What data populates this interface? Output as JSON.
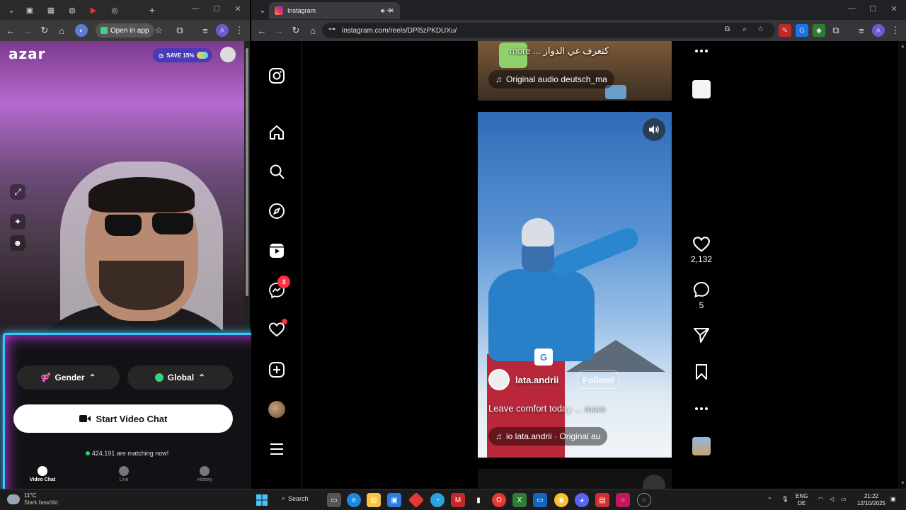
{
  "left_browser": {
    "toolbar": {
      "open_in_app_label": "Open in app",
      "profile_letter": "A"
    }
  },
  "azar": {
    "logo": "azar",
    "save_badge": "SAVE 15%",
    "gender_label": "Gender",
    "global_label": "Global",
    "start_button_label": "Start Video Chat",
    "matching_text": "424,191 are matching now!",
    "nav": [
      {
        "label": "Video Chat",
        "active": true
      },
      {
        "label": "Live",
        "active": false
      },
      {
        "label": "History",
        "active": false
      }
    ],
    "colors": {
      "neon_border": "#36c8ff",
      "neon_glow": "#d23bff",
      "matching_dot": "#27d36a"
    }
  },
  "right_browser": {
    "tab_title": "Instagram",
    "url": "instagram.com/reels/DPl5zPKDUXu/",
    "profile_letter": "A"
  },
  "instagram": {
    "messages_badge": "3",
    "prev_reel": {
      "caption": "كتعرف غي الدواز",
      "more": "more ...",
      "audio": "Original audio  deutsch_ma"
    },
    "reel": {
      "username": "lata.andrii",
      "follow_label": "Followi",
      "caption": "Leave comfort today",
      "more": "... more",
      "audio": "io  lata.andrii · Original au"
    },
    "actions": {
      "likes": "2,132",
      "comments": "5"
    },
    "colors": {
      "badge": "#ff3040"
    }
  },
  "taskbar": {
    "weather_temp": "11°C",
    "weather_desc": "Stark bewölkt",
    "search_label": "Search",
    "lang_top": "ENG",
    "lang_bottom": "DE",
    "time": "21:22",
    "date": "12/10/2025"
  }
}
